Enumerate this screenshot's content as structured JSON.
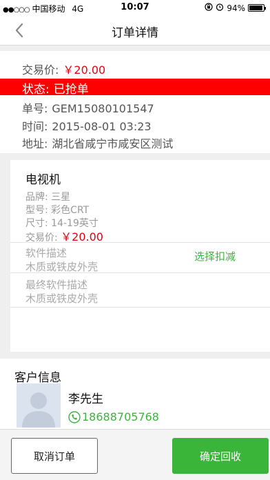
{
  "status_bar": {
    "signal": "●●○○○",
    "carrier": "中国移动",
    "network": "4G",
    "time": "10:07",
    "battery_text": "94%",
    "battery_level": 0.94
  },
  "nav": {
    "title": "订单详情",
    "back_icon": "chevron-left-icon"
  },
  "order": {
    "price_label": "交易价:",
    "price": "￥20.00",
    "status_label": "状态:",
    "status": "已抢单",
    "number_label": "单号:",
    "number": "GEM15080101547",
    "time_label": "时间:",
    "time": "2015-08-01 03:23",
    "address_label": "地址:",
    "address": "湖北省咸宁市咸安区测试",
    "status_color": "#ff0000",
    "price_color": "#e60012"
  },
  "item": {
    "title": "电视机",
    "brand_label": "品牌:",
    "brand": "三星",
    "model_label": "型号:",
    "model": "彩色CRT",
    "size_label": "尺寸:",
    "size": "14-19英寸",
    "price_label": "交易价:",
    "price": "￥20.00",
    "desc_label": "软件描述",
    "desc_value": "木质或铁皮外壳",
    "select_link": "选择扣减",
    "final_desc_label": "最终软件描述",
    "final_desc_value": "木质或铁皮外壳"
  },
  "customer": {
    "section_title": "客户信息",
    "name": "李先生",
    "phone": "18688705768",
    "phone_icon": "phone-icon",
    "accent_color": "#3cb43c"
  },
  "actions": {
    "cancel": "取消订单",
    "confirm": "确定回收",
    "confirm_color": "#3ab53a"
  }
}
